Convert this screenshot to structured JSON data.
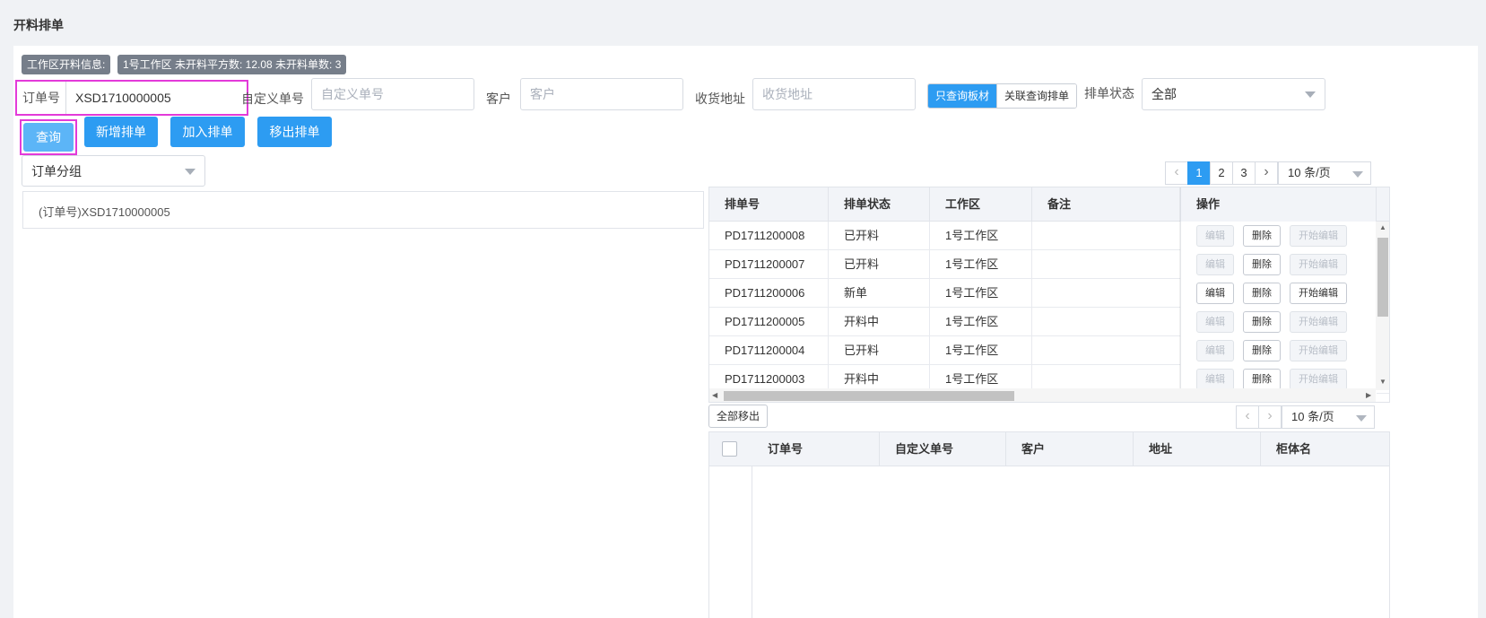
{
  "page": {
    "title": "开料排单"
  },
  "info": {
    "badge_label": "工作区开料信息:",
    "badge_value": "1号工作区 未开料平方数: 12.08 未开料单数: 3"
  },
  "filters": {
    "order_no": {
      "label": "订单号",
      "value": "XSD1710000005"
    },
    "custom_no": {
      "label": "自定义单号",
      "placeholder": "自定义单号"
    },
    "customer": {
      "label": "客户",
      "placeholder": "客户"
    },
    "address": {
      "label": "收货地址",
      "placeholder": "收货地址"
    },
    "mode": {
      "option_on": "只查询板材",
      "option_off": "关联查询排单"
    },
    "status": {
      "label": "排单状态",
      "value": "全部"
    }
  },
  "actions": {
    "query": "查询",
    "add_schedule": "新增排单",
    "join_schedule": "加入排单",
    "remove_schedule": "移出排单",
    "remove_all": "全部移出"
  },
  "group_select": {
    "value": "订单分组"
  },
  "tree": {
    "items": [
      "(订单号)XSD1710000005"
    ]
  },
  "pager": {
    "pages": [
      "1",
      "2",
      "3"
    ],
    "size": "10 条/页"
  },
  "pager2": {
    "size": "10 条/页"
  },
  "schedule_table": {
    "headers": [
      "排单号",
      "排单状态",
      "工作区",
      "备注",
      "操作"
    ],
    "op_labels": {
      "edit": "编辑",
      "delete": "删除",
      "start_edit": "开始编辑"
    },
    "rows": [
      {
        "no": "PD1711200008",
        "status": "已开料",
        "area": "1号工作区",
        "note": "",
        "editable": false
      },
      {
        "no": "PD1711200007",
        "status": "已开料",
        "area": "1号工作区",
        "note": "",
        "editable": false
      },
      {
        "no": "PD1711200006",
        "status": "新单",
        "area": "1号工作区",
        "note": "",
        "editable": true
      },
      {
        "no": "PD1711200005",
        "status": "开料中",
        "area": "1号工作区",
        "note": "",
        "editable": false
      },
      {
        "no": "PD1711200004",
        "status": "已开料",
        "area": "1号工作区",
        "note": "",
        "editable": false
      },
      {
        "no": "PD1711200003",
        "status": "开料中",
        "area": "1号工作区",
        "note": "",
        "editable": false
      }
    ]
  },
  "order_table": {
    "headers": [
      "订单号",
      "自定义单号",
      "客户",
      "地址",
      "柜体名"
    ]
  }
}
